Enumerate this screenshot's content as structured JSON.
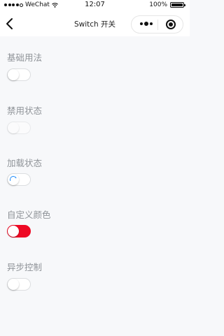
{
  "statusbar": {
    "carrier": "WeChat",
    "time": "12:07",
    "battery": "100%"
  },
  "navbar": {
    "title": "Switch 开关"
  },
  "sections": {
    "basic": {
      "title": "基础用法",
      "on": false
    },
    "disabled": {
      "title": "禁用状态",
      "on": false
    },
    "loading": {
      "title": "加载状态",
      "on": false
    },
    "custom_color": {
      "title": "自定义颜色",
      "on": true,
      "active_color": "#ee0a24"
    },
    "async": {
      "title": "异步控制",
      "on": false
    }
  },
  "colors": {
    "page_bg": "#f7f8fa",
    "title_text": "#8f9398",
    "spinner": "#1989fa"
  }
}
